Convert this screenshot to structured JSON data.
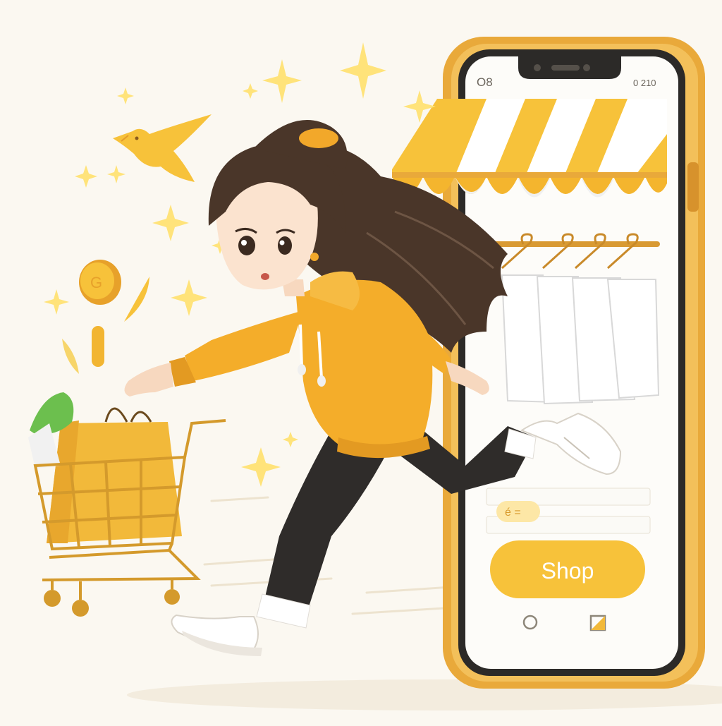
{
  "scene": {
    "description_colors": {
      "background": "#fbf8f1",
      "accent_yellow": "#f7c23a",
      "phone_frame": "#e9a93a",
      "hoodie": "#f4ad2a",
      "pants": "#2f2c2a",
      "hair": "#4a3629",
      "cart": "#d49a2c",
      "sparkle": "#ffe37a"
    }
  },
  "phone": {
    "status_left": "O8",
    "status_right": "0 210",
    "field_label": "é =",
    "shop_button_label": "Shop",
    "awning_colors": [
      "#f7c23a",
      "#ffffff"
    ]
  },
  "icons": {
    "bird": "bird-icon",
    "coin": "coin-icon",
    "sparkle": "sparkle-icon",
    "cart": "shopping-cart-icon",
    "hanger": "hanger-icon",
    "home": "home-circle-icon",
    "square": "square-icon"
  }
}
